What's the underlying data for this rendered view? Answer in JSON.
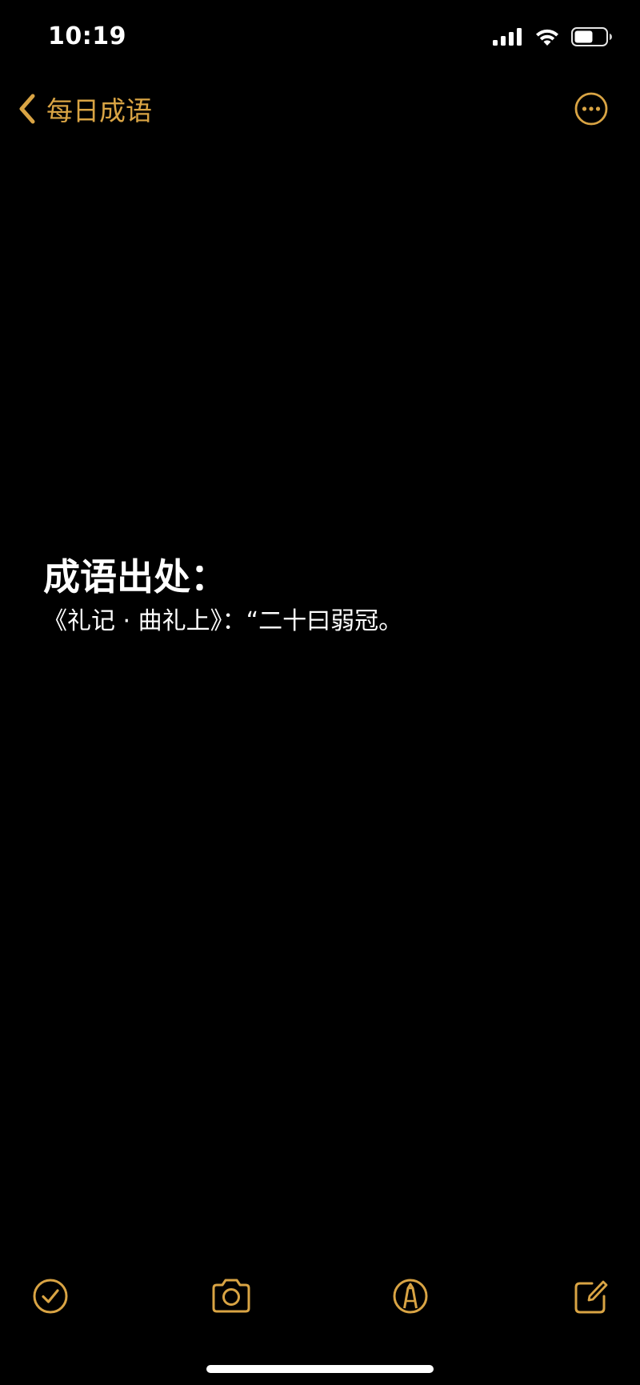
{
  "status_bar": {
    "time": "10:19",
    "icons": [
      "cellular-signal-icon",
      "wifi-icon",
      "battery-icon"
    ]
  },
  "nav": {
    "back_label": "每日成语",
    "back_icon": "chevron-left-icon",
    "more_icon": "ellipsis-circle-icon"
  },
  "note": {
    "heading": "成语出处：",
    "line": "《礼记 · 曲礼上》：“二十曰弱冠。"
  },
  "toolbar": {
    "items": [
      "checklist-icon",
      "camera-icon",
      "markup-pen-icon",
      "compose-icon"
    ]
  },
  "colors": {
    "background": "#000000",
    "accent": "#d9a444",
    "text": "#ffffff"
  }
}
